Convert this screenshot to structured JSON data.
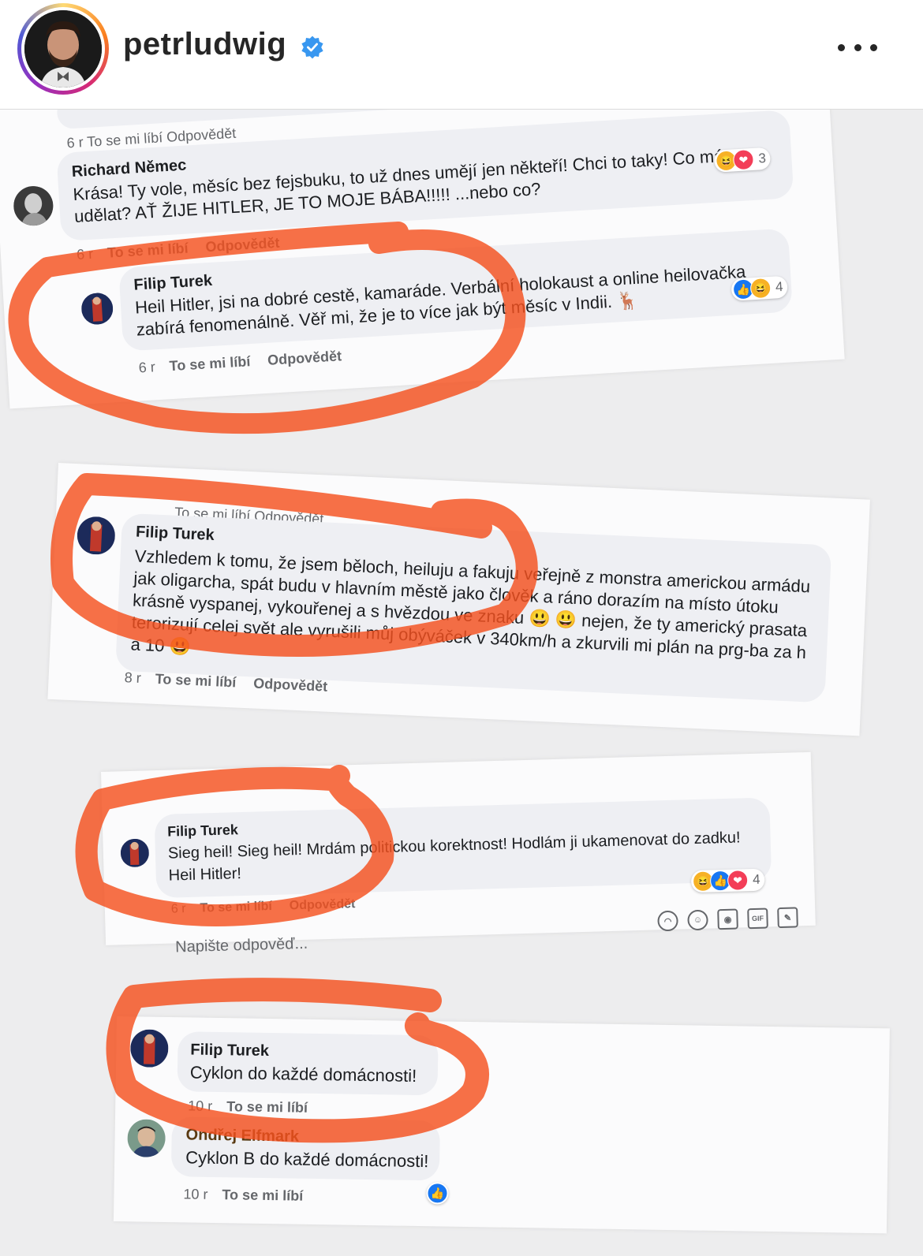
{
  "header": {
    "username": "petrludwig",
    "verified_icon": "verified-badge-icon",
    "more_icon": "more-options-icon"
  },
  "accent_colors": {
    "marker": "#f4511e",
    "facebook_blue": "#1877f2",
    "verified_blue": "#3897f0"
  },
  "screenshot_1": {
    "cut_meta": "6 r   To se mi líbí   Odpovědět",
    "comments": [
      {
        "author": "Richard Němec",
        "text": "Krása! Ty vole, měsíc bez fejsbuku, to už dnes umějí jen někteří! Chci to taky! Co mám udělat? AŤ ŽIJE HITLER, JE TO MOJE BÁBA!!!!! ...nebo co?",
        "time": "6 r",
        "like": "To se mi líbí",
        "reply": "Odpovědět",
        "reactions_count": "3"
      },
      {
        "author": "Filip Turek",
        "text": "Heil Hitler, jsi na dobré cestě, kamaráde. Verbální holokaust a online heilovačka zabírá fenomenálně. Věř mi, že je to více jak být měsíc v Indii. 🦌",
        "time": "6 r",
        "like": "To se mi líbí",
        "reply": "Odpovědět",
        "reactions_count": "4"
      }
    ]
  },
  "screenshot_2": {
    "cut_meta": "To se mi líbí   Odpovědět",
    "comment": {
      "author": "Filip Turek",
      "text": "Vzhledem k tomu, že jsem běloch, heiluju a fakuju veřejně z monstra americkou armádu jak oligarcha, spát budu v hlavním městě jako člověk a ráno dorazím na místo útoku krásně vyspanej, vykouřenej a s hvězdou ve znaku 😃 😃 nejen, že ty americký prasata terorizují celej svět ale vyrušili můj obýváček v 340km/h a zkurvili mi plán na prg-ba za h a 10 😃",
      "time": "8 r",
      "like": "To se mi líbí",
      "reply": "Odpovědět"
    }
  },
  "screenshot_3": {
    "comment": {
      "author": "Filip Turek",
      "text": "Sieg heil! Sieg heil! Mrdám politickou korektnost! Hodlám ji ukamenovat do zadku! Heil Hitler!",
      "time": "6 r",
      "like": "To se mi líbí",
      "reply": "Odpovědět",
      "reactions_count": "4"
    },
    "reply_placeholder": "Napište odpověď..."
  },
  "screenshot_4": {
    "comments": [
      {
        "author": "Filip Turek",
        "text": "Cyklon do každé domácnosti!",
        "time": "10 r",
        "like": "To se mi líbí"
      },
      {
        "author": "Ondřej Elfmark",
        "text": "Cyklon B do každé domácnosti!",
        "time": "10 r",
        "like": "To se mi líbí"
      }
    ]
  }
}
